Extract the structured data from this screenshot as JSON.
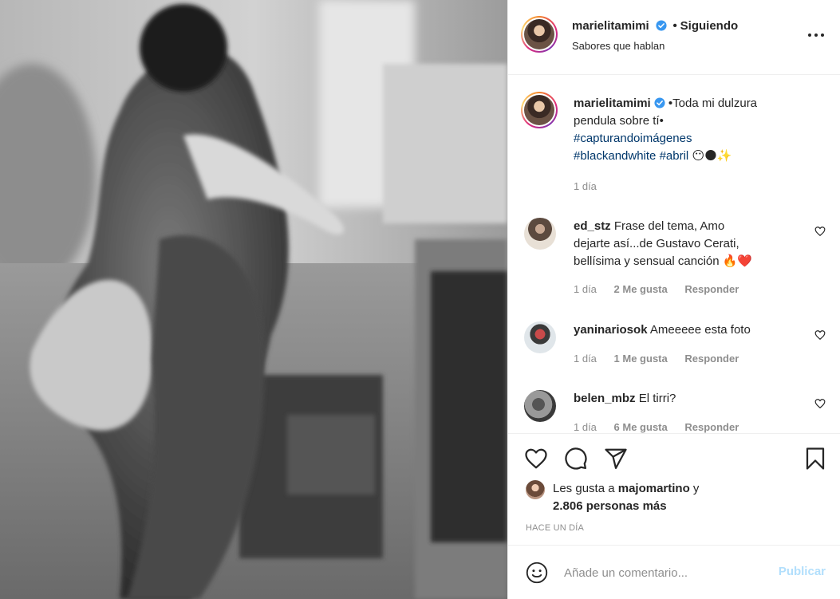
{
  "post": {
    "username": "marielitamimi",
    "follow_separator": "•",
    "follow_status": "Siguiendo",
    "subtitle": "Sabores que hablan",
    "caption": {
      "username": "marielitamimi",
      "text1": "•Toda mi dulzura",
      "text2": "pendula sobre tí•",
      "tag1": "#capturandoimágenes",
      "tag2": "#blackandwhite",
      "tag3": "#abril",
      "emojis": "😶🌑✨",
      "time": "1 día"
    },
    "comments": [
      {
        "username": "ed_stz",
        "text_lines": [
          "Frase del tema, Amo",
          "dejarte así...de Gustavo Cerati,",
          "bellísima y sensual canción 🔥❤️"
        ],
        "time": "1 día",
        "likes": "2 Me gusta",
        "reply": "Responder"
      },
      {
        "username": "yaninariosok",
        "text_lines": [
          "Ameeeee esta foto"
        ],
        "time": "1 día",
        "likes": "1 Me gusta",
        "reply": "Responder"
      },
      {
        "username": "belen_mbz",
        "text_lines": [
          "El tirri?"
        ],
        "time": "1 día",
        "likes": "6 Me gusta",
        "reply": "Responder"
      }
    ],
    "likes": {
      "prefix": "Les gusta a",
      "user": "majomartino",
      "conj": "y",
      "others": "2.806 personas más"
    },
    "timestamp": "HACE UN DÍA",
    "comment_placeholder": "Añade un comentario...",
    "publish_label": "Publicar"
  },
  "icons": {
    "verified": "verified-badge-icon",
    "more": "more-options-icon",
    "like": "heart-icon",
    "comment": "comment-icon",
    "share": "share-icon",
    "save": "bookmark-icon",
    "emoji": "emoji-icon"
  },
  "colors": {
    "verified": "#3897f0",
    "link": "#00376b",
    "muted": "#8e8e8e",
    "publish_disabled": "#b2dffc"
  }
}
